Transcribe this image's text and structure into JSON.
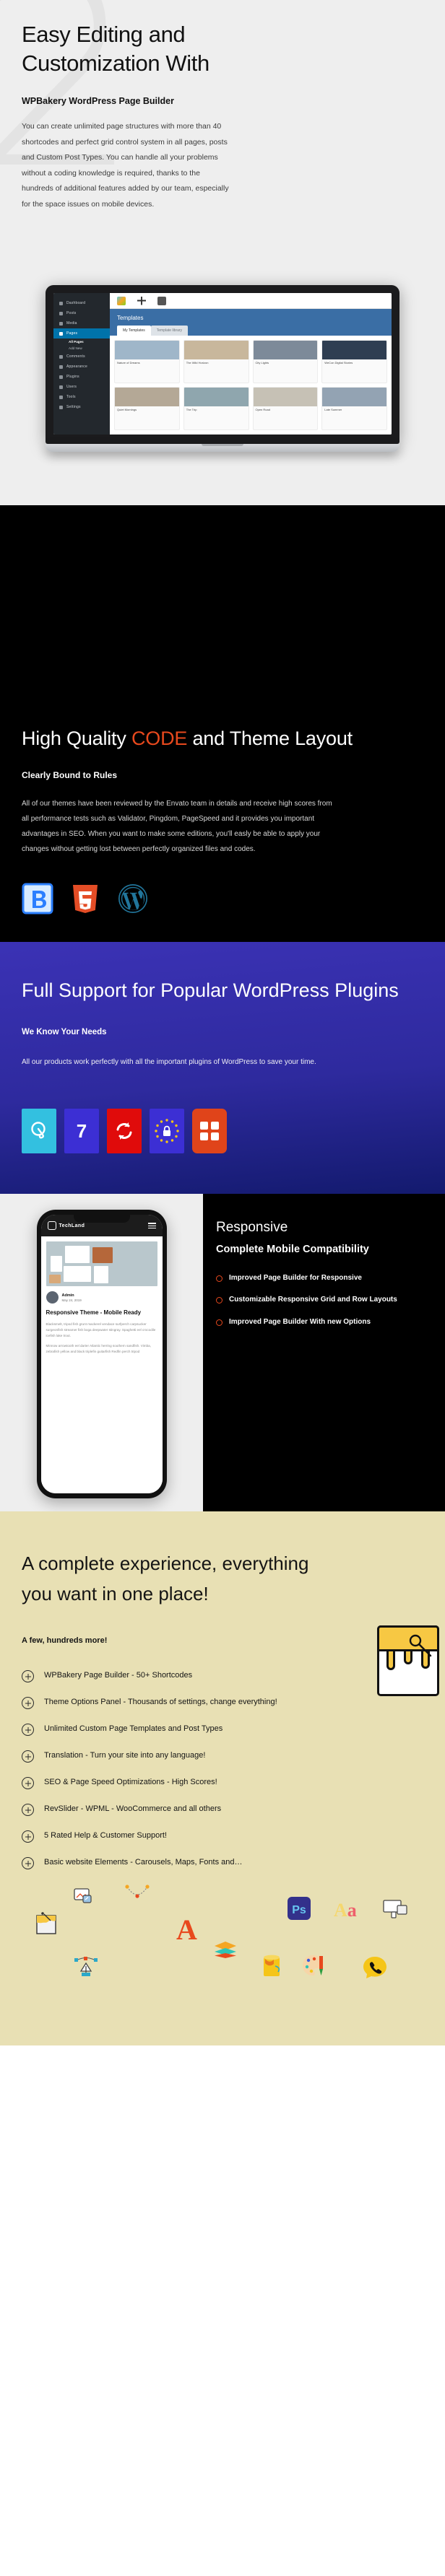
{
  "section_easy": {
    "heading": "Easy Editing and Customization With",
    "subheading": "WPBakery WordPress Page Builder",
    "paragraph": "You can create unlimited page structures with more than 40 shortcodes and perfect grid control system in all pages, posts and Custom Post Types. You can handle all your problems without a coding knowledge is required, thanks to the hundreds of additional features added by our team, especially for the space issues on mobile devices.",
    "watermark": "2",
    "laptop": {
      "sidebar_items": [
        {
          "label": "Dashboard",
          "active": false
        },
        {
          "label": "Posts",
          "active": false
        },
        {
          "label": "Media",
          "active": false
        },
        {
          "label": "Pages",
          "active": true
        }
      ],
      "sidebar_subitems": [
        {
          "label": "All Pages",
          "bold": true
        },
        {
          "label": "Add New",
          "bold": false
        }
      ],
      "sidebar_items_tail": [
        {
          "label": "Comments",
          "active": false
        },
        {
          "label": "Appearance",
          "active": false
        },
        {
          "label": "Plugins",
          "active": false
        },
        {
          "label": "Users",
          "active": false
        },
        {
          "label": "Tools",
          "active": false
        },
        {
          "label": "Settings",
          "active": false
        }
      ],
      "panel_title": "Templates",
      "tabs": [
        {
          "label": "My Templates",
          "active": true
        },
        {
          "label": "Template library",
          "active": false
        }
      ],
      "cards": [
        {
          "caption": "Nature of Dreams",
          "color": "#9fb6c9"
        },
        {
          "caption": "The Wild Horizon",
          "color": "#c8b79c"
        },
        {
          "caption": "City Lights",
          "color": "#7d8a99"
        },
        {
          "caption": "WeCon Digital Stories",
          "color": "#2f3e52"
        },
        {
          "caption": "Quiet Mornings",
          "color": "#b4a896"
        },
        {
          "caption": "The Trip",
          "color": "#8fa6ae"
        },
        {
          "caption": "Open Road",
          "color": "#c6c1b5"
        },
        {
          "caption": "Late Summer",
          "color": "#93a3b3"
        }
      ]
    }
  },
  "section_code": {
    "heading_part1": "High Quality ",
    "heading_highlight": "CODE",
    "heading_part2": " and Theme Layout",
    "highlight_color": "#e8491d",
    "subheading": "Clearly Bound to Rules",
    "paragraph": "All of our themes have been reviewed by the Envato team in details and receive high scores from all performance tests such as Validator, Pingdom, PageSpeed and it provides you important advantages in SEO. When you want to make some editions, you'll easly be able to apply your changes without getting lost between perfectly organized files and codes.",
    "tech_logos": [
      {
        "name": "bootstrap-logo",
        "label": "B",
        "color": "#2b7fff"
      },
      {
        "name": "html5-logo",
        "label": "5",
        "color": "#e44d26"
      },
      {
        "name": "wordpress-logo",
        "label": "W",
        "color": "#21759b"
      }
    ]
  },
  "section_blue": {
    "heading": "Full Support for Popular WordPress Plugins",
    "subheading": "We Know Your Needs",
    "paragraph": "All our products work perfectly with all the important plugins of WordPress to save your time.",
    "background_color": "#2e2a9e",
    "plugins": [
      {
        "name": "slider-revolution-icon",
        "label": "Q",
        "color": "#33c0e0"
      },
      {
        "name": "contact-form-7-icon",
        "label": "7",
        "color": "#3c2fd4"
      },
      {
        "name": "wpml-icon",
        "label": "↻",
        "color": "#e00b0b"
      },
      {
        "name": "gdpr-icon",
        "label": "🔒",
        "color": "#3c2fd4"
      },
      {
        "name": "visual-composer-icon",
        "label": "▦",
        "color": "#e0441a"
      }
    ]
  },
  "section_responsive": {
    "heading": "Responsive",
    "subheading": "Complete Mobile Compatibility",
    "bullet_color": "#e8491d",
    "bullets": [
      "Improved Page Builder for Responsive",
      "Customizable Responsive Grid and Row Layouts",
      "Improved Page Builder With new Options"
    ],
    "phone": {
      "site_name": "TechLand",
      "author": "Admin",
      "date": "May 24, 2019",
      "post_title": "Responsive Theme - Mobile Ready",
      "post_paragraph_1": "Blacksmelt, tripod fish grunt mackerel vendace surfperch carpsucker surgeonfish streamer fish boga deepwater stingray. Spaghetti eel crocodile icefish lake trout.",
      "post_paragraph_2": "Minnow arrowtooth eel darter Atlantic herring southern sandfish. Vimba, zebrafish yellow and black triplefin guitarfish Redfin perch tripod"
    }
  },
  "section_cream": {
    "heading": "A complete experience, everything you want in one place!",
    "subheading": "A few, hundreds more!",
    "background_color": "#e8e0b4",
    "features": [
      "WPBakery Page Builder - 50+ Shortcodes",
      "Theme Options Panel - Thousands of settings, change everything!",
      "Unlimited Custom Page Templates and Post Types",
      "Translation - Turn your site into any language!",
      "SEO & Page Speed Optimizations - High Scores!",
      "RevSlider - WPML - WooCommerce and all others",
      "5 Rated Help & Customer Support!",
      "Basic website Elements - Carousels, Maps, Fonts and…"
    ],
    "icons": [
      {
        "name": "paint-bucket-icon",
        "glyph": "🪣"
      },
      {
        "name": "image-edit-icon",
        "glyph": "🖼"
      },
      {
        "name": "bezier-curve-icon",
        "glyph": "✒"
      },
      {
        "name": "serif-letter-a-icon",
        "glyph": "A"
      },
      {
        "name": "layers-icon",
        "glyph": "≡"
      },
      {
        "name": "photoshop-icon",
        "glyph": "Ps"
      },
      {
        "name": "typography-aa-icon",
        "glyph": "Aa"
      },
      {
        "name": "responsive-devices-icon",
        "glyph": "⬚"
      },
      {
        "name": "paint-can-icon",
        "glyph": "🪣"
      },
      {
        "name": "color-palette-icon",
        "glyph": "🎨"
      },
      {
        "name": "phone-support-icon",
        "glyph": "📞"
      },
      {
        "name": "pen-tool-icon",
        "glyph": "✒"
      }
    ]
  }
}
